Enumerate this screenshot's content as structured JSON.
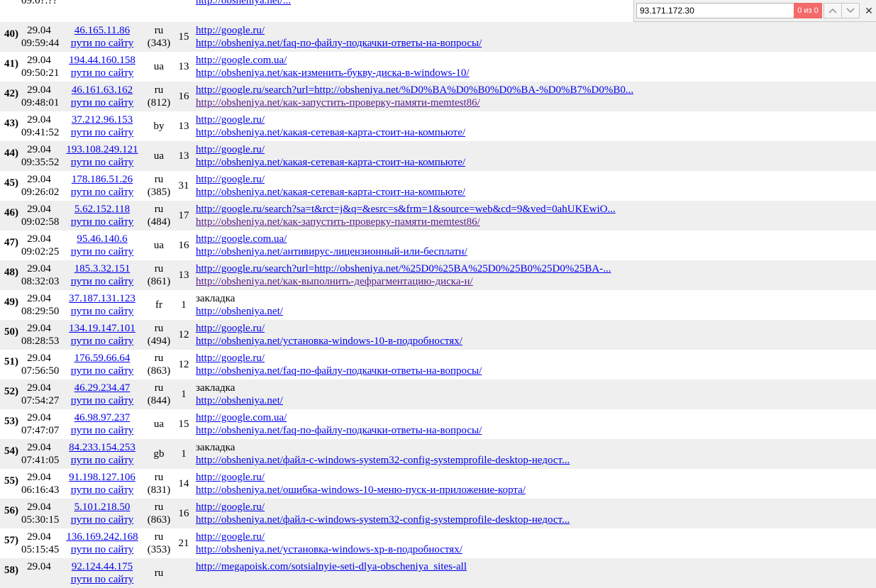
{
  "findbar": {
    "query": "93.171.172.30",
    "count": "0 из 0",
    "prev_icon": "chevron-up-icon",
    "next_icon": "chevron-down-icon",
    "close_icon": "close-icon"
  },
  "path_label": "пути по сайту",
  "rows": [
    {
      "num": "",
      "date": "",
      "time": "09:0?:??",
      "ip": "",
      "cc": "",
      "count": "",
      "cnt": "",
      "ref": "",
      "page": "http://obsheniya.net/..."
    },
    {
      "num": "40)",
      "date": "29.04",
      "time": "09:59:44",
      "ip": "46.165.11.86",
      "cc": "ru",
      "count": "(343)",
      "cnt": "15",
      "ref": "http://google.ru/",
      "page": "http://obsheniya.net/faq-по-файлу-подкачки-ответы-на-вопросы/"
    },
    {
      "num": "41)",
      "date": "29.04",
      "time": "09:50:21",
      "ip": "194.44.160.158",
      "cc": "ua",
      "count": "",
      "cnt": "13",
      "ref": "http://google.com.ua/",
      "page": "http://obsheniya.net/как-изменить-букву-диска-в-windows-10/"
    },
    {
      "num": "42)",
      "date": "29.04",
      "time": "09:48:01",
      "ip": "46.161.63.162",
      "cc": "ru",
      "count": "(812)",
      "cnt": "16",
      "ref": "http://google.ru/search?url=http://obsheniya.net/%D0%BA%D0%B0%D0%BA-%D0%B7%D0%B0...",
      "page": "http://obsheniya.net/как-запустить-проверку-памяти-memtest86/",
      "pv": true
    },
    {
      "num": "43)",
      "date": "29.04",
      "time": "09:41:52",
      "ip": "37.212.96.153",
      "cc": "by",
      "count": "",
      "cnt": "13",
      "ref": "http://google.ru/",
      "page": "http://obsheniya.net/какая-сетевая-карта-стоит-на-компьюте/"
    },
    {
      "num": "44)",
      "date": "29.04",
      "time": "09:35:52",
      "ip": "193.108.249.121",
      "cc": "ua",
      "count": "",
      "cnt": "13",
      "ref": "http://google.ru/",
      "page": "http://obsheniya.net/какая-сетевая-карта-стоит-на-компьюте/"
    },
    {
      "num": "45)",
      "date": "29.04",
      "time": "09:26:02",
      "ip": "178.186.51.26",
      "cc": "ru",
      "count": "(385)",
      "cnt": "31",
      "ref": "http://google.ru/",
      "page": "http://obsheniya.net/какая-сетевая-карта-стоит-на-компьюте/"
    },
    {
      "num": "46)",
      "date": "29.04",
      "time": "09:02:58",
      "ip": "5.62.152.118",
      "cc": "ru",
      "count": "(484)",
      "cnt": "17",
      "ref": "http://google.ru/search?sa=t&rct=j&q=&esrc=s&frm=1&source=web&cd=9&ved=0ahUKEwiO...",
      "page": "http://obsheniya.net/как-запустить-проверку-памяти-memtest86/",
      "pv": true
    },
    {
      "num": "47)",
      "date": "29.04",
      "time": "09:02:25",
      "ip": "95.46.140.6",
      "cc": "ua",
      "count": "",
      "cnt": "16",
      "ref": "http://google.com.ua/",
      "page": "http://obsheniya.net/антивирус-лицензионный-или-бесплатн/"
    },
    {
      "num": "48)",
      "date": "29.04",
      "time": "08:32:03",
      "ip": "185.3.32.151",
      "cc": "ru",
      "count": "(861)",
      "cnt": "13",
      "ref": "http://google.ru/search?url=http://obsheniya.net/%25D0%25BA%25D0%25B0%25D0%25BA-...",
      "page": "http://obsheniya.net/как-выполнить-дефрагментацию-диска-н/",
      "pv": true
    },
    {
      "num": "49)",
      "date": "29.04",
      "time": "08:29:50",
      "ip": "37.187.131.123",
      "cc": "fr",
      "count": "",
      "cnt": "1",
      "ref": "закладка",
      "ref_plain": true,
      "page": "http://obsheniya.net/"
    },
    {
      "num": "50)",
      "date": "29.04",
      "time": "08:28:53",
      "ip": "134.19.147.101",
      "cc": "ru",
      "count": "(494)",
      "cnt": "12",
      "ref": "http://google.ru/",
      "page": "http://obsheniya.net/установка-windows-10-в-подробностях/"
    },
    {
      "num": "51)",
      "date": "29.04",
      "time": "07:56:50",
      "ip": "176.59.66.64",
      "cc": "ru",
      "count": "(863)",
      "cnt": "12",
      "ref": "http://google.ru/",
      "page": "http://obsheniya.net/faq-по-файлу-подкачки-ответы-на-вопросы/"
    },
    {
      "num": "52)",
      "date": "29.04",
      "time": "07:54:27",
      "ip": "46.29.234.47",
      "cc": "ru",
      "count": "(844)",
      "cnt": "1",
      "ref": "закладка",
      "ref_plain": true,
      "page": "http://obsheniya.net/"
    },
    {
      "num": "53)",
      "date": "29.04",
      "time": "07:47:07",
      "ip": "46.98.97.237",
      "cc": "ua",
      "count": "",
      "cnt": "15",
      "ref": "http://google.com.ua/",
      "page": "http://obsheniya.net/faq-по-файлу-подкачки-ответы-на-вопросы/"
    },
    {
      "num": "54)",
      "date": "29.04",
      "time": "07:41:05",
      "ip": "84.233.154.253",
      "cc": "gb",
      "count": "",
      "cnt": "1",
      "ref": "закладка",
      "ref_plain": true,
      "page": "http://obsheniya.net/файл-c-windows-system32-config-systemprofile-desktop-недост..."
    },
    {
      "num": "55)",
      "date": "29.04",
      "time": "06:16:43",
      "ip": "91.198.127.106",
      "cc": "ru",
      "count": "(831)",
      "cnt": "14",
      "ref": "http://google.ru/",
      "page": "http://obsheniya.net/ошибка-windows-10-меню-пуск-и-приложение-корта/"
    },
    {
      "num": "56)",
      "date": "29.04",
      "time": "05:30:15",
      "ip": "5.101.218.50",
      "cc": "ru",
      "count": "(863)",
      "cnt": "16",
      "ref": "http://google.ru/",
      "page": "http://obsheniya.net/файл-c-windows-system32-config-systemprofile-desktop-недост..."
    },
    {
      "num": "57)",
      "date": "29.04",
      "time": "05:15:45",
      "ip": "136.169.242.168",
      "cc": "ru",
      "count": "(353)",
      "cnt": "21",
      "ref": "http://google.ru/",
      "page": "http://obsheniya.net/установка-windows-xp-в-подробностях/"
    },
    {
      "num": "58)",
      "date": "29.04",
      "time": "",
      "ip": "92.124.44.175",
      "cc": "ru",
      "count": "",
      "cnt": "",
      "ref": "http://megapoisk.com/sotsialnyie-seti-dlya-obscheniya_sites-all",
      "page": ""
    }
  ]
}
